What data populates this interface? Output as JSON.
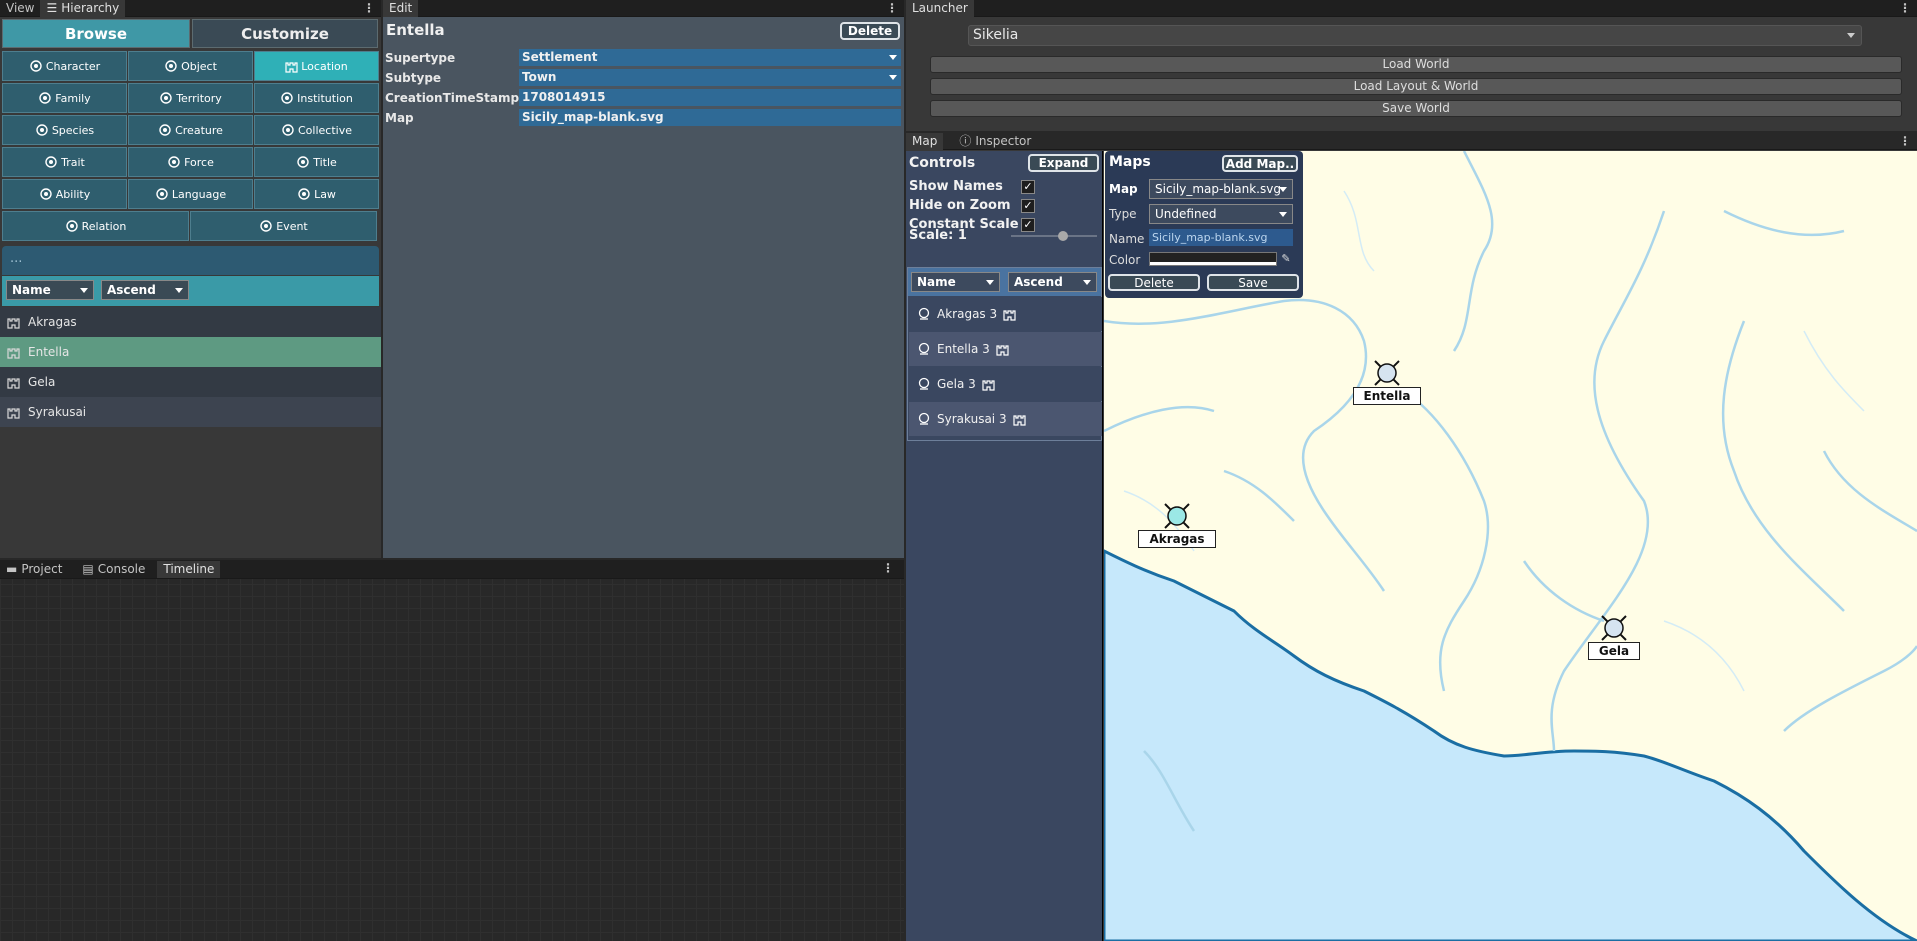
{
  "hierarchy": {
    "tabs": [
      "View",
      "Hierarchy"
    ],
    "segments": {
      "browse": "Browse",
      "customize": "Customize"
    },
    "categories": [
      {
        "label": "Character",
        "icon": "character-icon"
      },
      {
        "label": "Object",
        "icon": "object-icon"
      },
      {
        "label": "Location",
        "icon": "location-icon"
      },
      {
        "label": "Family",
        "icon": "family-icon"
      },
      {
        "label": "Territory",
        "icon": "territory-icon"
      },
      {
        "label": "Institution",
        "icon": "institution-icon"
      },
      {
        "label": "Species",
        "icon": "species-icon"
      },
      {
        "label": "Creature",
        "icon": "creature-icon"
      },
      {
        "label": "Collective",
        "icon": "collective-icon"
      },
      {
        "label": "Trait",
        "icon": "trait-icon"
      },
      {
        "label": "Force",
        "icon": "force-icon"
      },
      {
        "label": "Title",
        "icon": "title-icon"
      },
      {
        "label": "Ability",
        "icon": "ability-icon"
      },
      {
        "label": "Language",
        "icon": "language-icon"
      },
      {
        "label": "Law",
        "icon": "law-icon"
      },
      {
        "label": "Relation",
        "icon": "relation-icon"
      },
      {
        "label": "Event",
        "icon": "event-icon"
      }
    ],
    "selected_category": "Location",
    "filter_text": "...",
    "sort_field": "Name",
    "sort_order": "Ascend",
    "items": [
      "Akragas",
      "Entella",
      "Gela",
      "Syrakusai"
    ],
    "selected_item": "Entella"
  },
  "edit": {
    "tab": "Edit",
    "title": "Entella",
    "delete_label": "Delete",
    "fields": [
      {
        "label": "Supertype",
        "value": "Settlement",
        "dropdown": true
      },
      {
        "label": "Subtype",
        "value": "Town",
        "dropdown": true
      },
      {
        "label": "CreationTimeStamp",
        "value": "1708014915",
        "dropdown": false
      },
      {
        "label": "Map",
        "value": "Sicily_map-blank.svg",
        "dropdown": false
      }
    ]
  },
  "bottom": {
    "tabs": [
      "Project",
      "Console",
      "Timeline"
    ],
    "active_tab": "Timeline"
  },
  "launcher": {
    "tab": "Launcher",
    "world": "Sikelia",
    "buttons": [
      "Load World",
      "Load Layout & World",
      "Save World"
    ]
  },
  "map_panel": {
    "tabs": [
      "Map",
      "Inspector"
    ],
    "controls": {
      "title": "Controls",
      "expand_label": "Expand",
      "toggles": [
        {
          "label": "Show Names",
          "checked": true
        },
        {
          "label": "Hide on Zoom",
          "checked": true
        },
        {
          "label": "Constant Scale",
          "checked": true
        }
      ],
      "scale_label": "Scale: 1",
      "scale_value": 0.6,
      "sort_field": "Name",
      "sort_order": "Ascend",
      "items": [
        "Akragas 3",
        "Entella 3",
        "Gela 3",
        "Syrakusai 3"
      ]
    },
    "maps": {
      "title": "Maps",
      "add_label": "Add Map..",
      "map_label": "Map",
      "map_value": "Sicily_map-blank.svg",
      "type_label": "Type",
      "type_value": "Undefined",
      "name_label": "Name",
      "name_value": "Sicily_map-blank.svg",
      "color_label": "Color",
      "delete_label": "Delete",
      "save_label": "Save"
    },
    "markers": [
      "Entella",
      "Akragas",
      "Gela"
    ],
    "colors": {
      "land": "#fffde6",
      "sea": "#c6e8fb",
      "coast": "#1a6ea3"
    }
  }
}
